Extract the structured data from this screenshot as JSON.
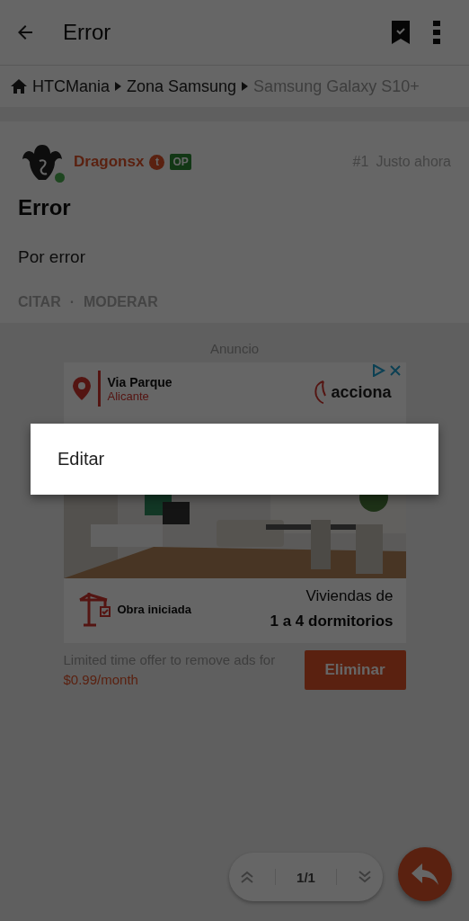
{
  "app_bar": {
    "title": "Error"
  },
  "breadcrumb": [
    {
      "label": "HTCMania",
      "current": false
    },
    {
      "label": "Zona Samsung",
      "current": false
    },
    {
      "label": "Samsung Galaxy S10+",
      "current": true
    }
  ],
  "post": {
    "author": "Dragonsx",
    "online": true,
    "rank_badge": "t",
    "badge": "OP",
    "number": "#1",
    "time": "Justo ahora",
    "title": "Error",
    "body": "Por error",
    "actions": [
      "CITAR",
      "MODERAR"
    ],
    "separator": "·"
  },
  "ad": {
    "label": "Anuncio",
    "location": "Via Parque",
    "city": "Alicante",
    "brand": "acciona",
    "status": "Obra iniciada",
    "headline": "Viviendas de",
    "subheadline": "1 a 4 dormitorios"
  },
  "remove_ads": {
    "text": "Limited time offer to remove ads for",
    "price": "$0.99/month",
    "button": "Eliminar"
  },
  "pager": {
    "page": "1/1"
  },
  "menu": {
    "items": [
      "Editar"
    ]
  }
}
